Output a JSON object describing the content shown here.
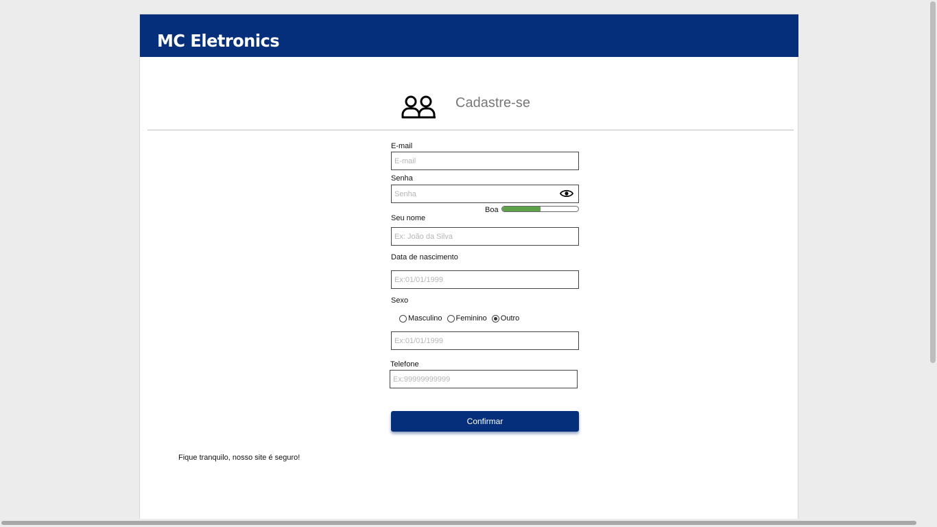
{
  "header": {
    "brand": "MC Eletronics",
    "background_color": "#052f7a"
  },
  "main": {
    "title": "Cadastre-se",
    "title_icon": "users-icon"
  },
  "form": {
    "email": {
      "label": "E-mail",
      "placeholder": "E-mail",
      "value": ""
    },
    "password": {
      "label": "Senha",
      "placeholder": "Senha",
      "value": "",
      "toggle_icon": "eye-icon",
      "strength_label": "Boa",
      "strength_level": 0.5,
      "strength_color": "#5da148"
    },
    "name": {
      "label": "Seu nome",
      "placeholder": "Ex: João da Silva",
      "value": ""
    },
    "birthdate": {
      "label": "Data de nascimento",
      "placeholder": "Ex:01/01/1999",
      "value": ""
    },
    "sex": {
      "label": "Sexo",
      "options": [
        "Masculino",
        "Feminino",
        "Outro"
      ],
      "selected": "Outro",
      "other_field_placeholder": "Ex:01/01/1999"
    },
    "phone": {
      "label": "Telefone",
      "placeholder": "Ex:99999999999",
      "value": ""
    },
    "confirm_label": "Confirmar"
  },
  "footer_note": "Fique tranquilo, nosso site é seguro!"
}
